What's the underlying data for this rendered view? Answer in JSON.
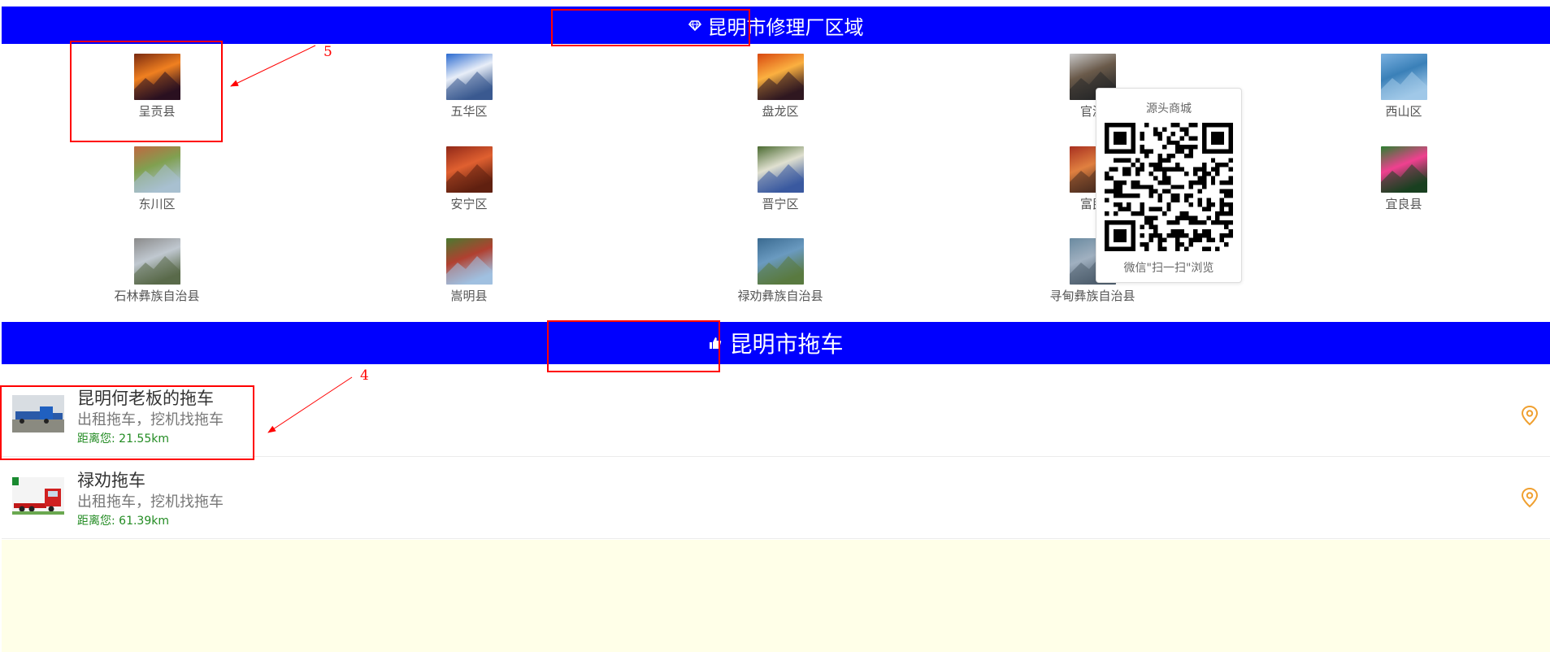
{
  "section1": {
    "title": "昆明市修理厂区域",
    "icon": "diamond-icon"
  },
  "districts": [
    {
      "label": "呈贡县",
      "colors": [
        "#7a2a10",
        "#f08020",
        "#2a1020"
      ]
    },
    {
      "label": "五华区",
      "colors": [
        "#2a6ad0",
        "#e8eef8",
        "#3a5a90"
      ]
    },
    {
      "label": "盘龙区",
      "colors": [
        "#d84810",
        "#fbb040",
        "#301820"
      ]
    },
    {
      "label": "官渡",
      "colors": [
        "#c8c8c8",
        "#6a5a4a",
        "#2a2a2a"
      ]
    },
    {
      "label": "西山区",
      "colors": [
        "#7ab0e0",
        "#3a80b8",
        "#a0c8e8"
      ]
    },
    {
      "label": "东川区",
      "colors": [
        "#c06840",
        "#80a050",
        "#a8c0d0"
      ]
    },
    {
      "label": "安宁区",
      "colors": [
        "#902818",
        "#e06030",
        "#602010"
      ]
    },
    {
      "label": "晋宁区",
      "colors": [
        "#4a6a30",
        "#e0e0d0",
        "#3a5aa0"
      ]
    },
    {
      "label": "富民",
      "colors": [
        "#a83020",
        "#e08040",
        "#503020"
      ]
    },
    {
      "label": "宜良县",
      "colors": [
        "#2a8030",
        "#f04090",
        "#1a4020"
      ]
    },
    {
      "label": "石林彝族自治县",
      "colors": [
        "#8a8a8a",
        "#c0c8d0",
        "#5a6a4a"
      ]
    },
    {
      "label": "嵩明县",
      "colors": [
        "#4a7a30",
        "#b04030",
        "#a0c0e0"
      ]
    },
    {
      "label": "禄劝彝族自治县",
      "colors": [
        "#3a6a90",
        "#6a9ac0",
        "#5a7a40"
      ]
    },
    {
      "label": "寻甸彝族自治县",
      "colors": [
        "#6a8aa0",
        "#a0b0c0",
        "#506070"
      ]
    }
  ],
  "section2": {
    "title": "昆明市拖车",
    "icon": "thumbs-up-icon"
  },
  "listings": [
    {
      "name": "昆明何老板的拖车",
      "desc": "出租拖车，挖机找拖车",
      "distance": "距离您: 21.55km"
    },
    {
      "name": "禄劝拖车",
      "desc": "出租拖车，挖机找拖车",
      "distance": "距离您: 61.39km"
    }
  ],
  "qr_popup": {
    "title": "源头商城",
    "footer": "微信\"扫一扫\"浏览"
  },
  "annotations": [
    "5",
    "4"
  ],
  "colors": {
    "banner": "#0000ff",
    "distance": "#228b22",
    "location_pin": "#f0a030",
    "footer_bg": "#ffffe8",
    "annotation": "#ff0000"
  }
}
